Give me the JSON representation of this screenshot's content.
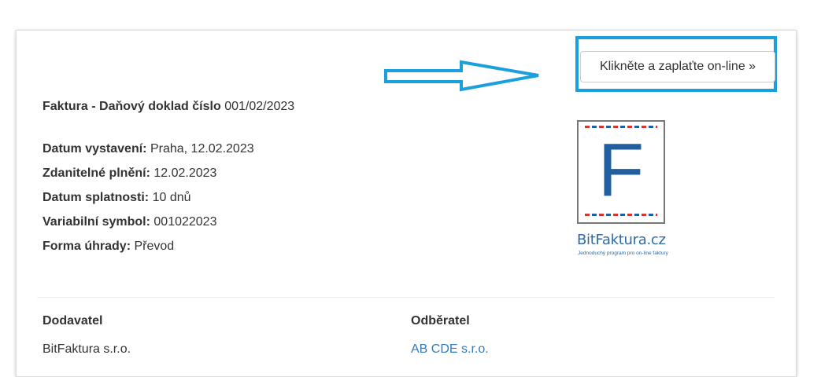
{
  "pay_button": {
    "label": "Klikněte a zaplaťte on-line »"
  },
  "invoice": {
    "title_label": "Faktura - Daňový doklad číslo",
    "number": "001/02/2023"
  },
  "meta": [
    {
      "label": "Datum vystavení:",
      "value": "Praha, 12.02.2023"
    },
    {
      "label": "Zdanitelné plnění:",
      "value": "12.02.2023"
    },
    {
      "label": "Datum splatnosti:",
      "value": "10 dnů"
    },
    {
      "label": "Variabilní symbol:",
      "value": "001022023"
    },
    {
      "label": "Forma úhrady:",
      "value": "Převod"
    }
  ],
  "logo": {
    "letter": "F",
    "name": "BitFaktura.cz",
    "tagline": "Jednoduchý program pro on-line faktury"
  },
  "supplier": {
    "heading": "Dodavatel",
    "name": "BitFaktura s.r.o."
  },
  "customer": {
    "heading": "Odběratel",
    "name": "AB CDE s.r.o."
  },
  "colors": {
    "highlight": "#1ba0de",
    "link": "#337ab7",
    "logo_blue": "#2060a0"
  }
}
